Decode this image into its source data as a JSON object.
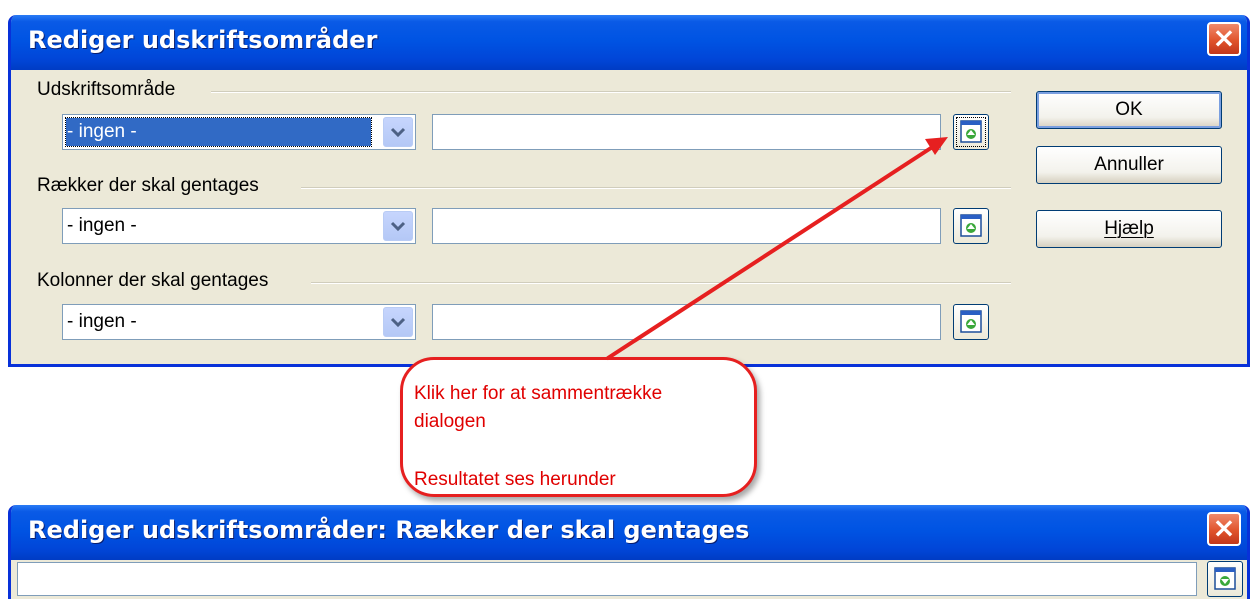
{
  "dialog_main": {
    "title": "Rediger udskriftsområder",
    "close_glyph": "×",
    "groups": [
      {
        "label": "Udskriftsområde",
        "combo_value": "- ingen -",
        "combo_selected": true,
        "range_value": ""
      },
      {
        "label": "Rækker der skal gentages",
        "combo_value": "- ingen -",
        "combo_selected": false,
        "range_value": ""
      },
      {
        "label": "Kolonner der skal gentages",
        "combo_value": "- ingen -",
        "combo_selected": false,
        "range_value": ""
      }
    ],
    "buttons": {
      "ok": "OK",
      "cancel": "Annuller",
      "help": "Hjælp"
    }
  },
  "annotation": {
    "line1": "Klik her for at sammentrække",
    "line2": "dialogen",
    "line3": "Resultatet ses herunder",
    "color": "#e00000"
  },
  "dialog_collapsed": {
    "title": "Rediger udskriftsområder: Rækker der skal gentages",
    "close_glyph": "×",
    "range_value": ""
  },
  "icons": {
    "shrink": "shrink-dialog-icon",
    "expand": "expand-dialog-icon",
    "dropdown": "chevron-down-icon",
    "close": "close-icon"
  },
  "colors": {
    "titlebar": "#0054e3",
    "dialog_bg": "#ece9d8",
    "accent_red": "#e62020",
    "selection": "#316ac5"
  }
}
